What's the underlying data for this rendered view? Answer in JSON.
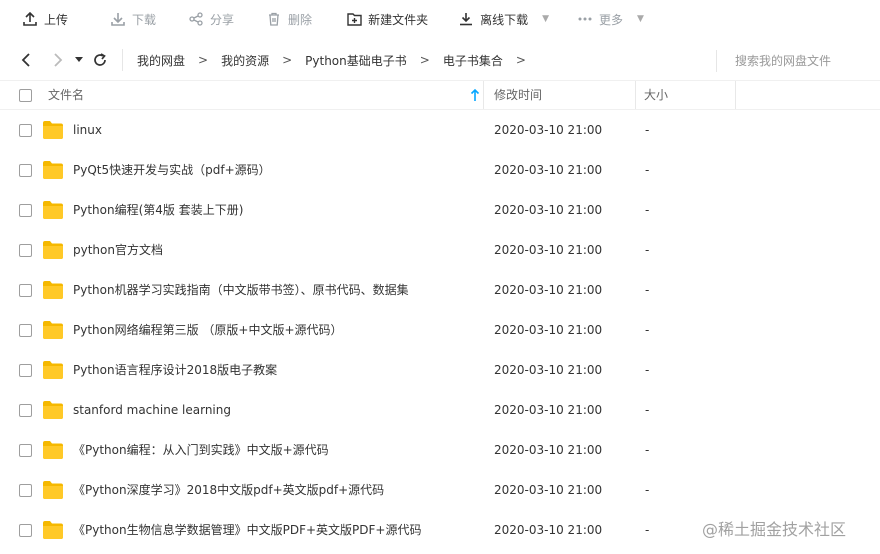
{
  "toolbar": {
    "upload": "上传",
    "download": "下载",
    "share": "分享",
    "delete": "删除",
    "new_folder": "新建文件夹",
    "offline_download": "离线下载",
    "more": "更多"
  },
  "nav": {
    "breadcrumbs": [
      "我的网盘",
      "我的资源",
      "Python基础电子书",
      "电子书集合"
    ],
    "search_placeholder": "搜索我的网盘文件"
  },
  "table": {
    "headers": {
      "name": "文件名",
      "modified": "修改时间",
      "size": "大小"
    },
    "rows": [
      {
        "name": "linux",
        "modified": "2020-03-10 21:00",
        "size": "-"
      },
      {
        "name": "PyQt5快速开发与实战（pdf+源码）",
        "modified": "2020-03-10 21:00",
        "size": "-"
      },
      {
        "name": "Python编程(第4版 套装上下册)",
        "modified": "2020-03-10 21:00",
        "size": "-"
      },
      {
        "name": "python官方文档",
        "modified": "2020-03-10 21:00",
        "size": "-"
      },
      {
        "name": "Python机器学习实践指南（中文版带书签）、原书代码、数据集",
        "modified": "2020-03-10 21:00",
        "size": "-"
      },
      {
        "name": "Python网络编程第三版 （原版+中文版+源代码）",
        "modified": "2020-03-10 21:00",
        "size": "-"
      },
      {
        "name": "Python语言程序设计2018版电子教案",
        "modified": "2020-03-10 21:00",
        "size": "-"
      },
      {
        "name": "stanford machine learning",
        "modified": "2020-03-10 21:00",
        "size": "-"
      },
      {
        "name": "《Python编程：从入门到实践》中文版+源代码",
        "modified": "2020-03-10 21:00",
        "size": "-"
      },
      {
        "name": "《Python深度学习》2018中文版pdf+英文版pdf+源代码",
        "modified": "2020-03-10 21:00",
        "size": "-"
      },
      {
        "name": "《Python生物信息学数据管理》中文版PDF+英文版PDF+源代码",
        "modified": "2020-03-10 21:00",
        "size": "-"
      }
    ]
  },
  "watermark": "@稀土掘金技术社区",
  "colors": {
    "folder": "#FFC928",
    "folder_tab": "#F5B800",
    "accent": "#06a7ff"
  }
}
